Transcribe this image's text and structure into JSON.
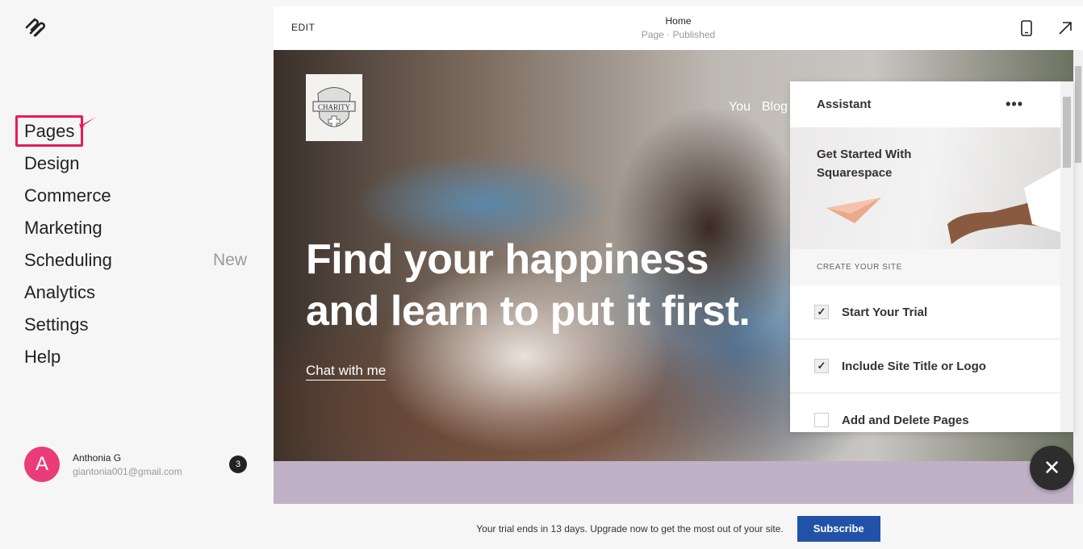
{
  "sidebar": {
    "items": [
      {
        "label": "Pages"
      },
      {
        "label": "Design"
      },
      {
        "label": "Commerce"
      },
      {
        "label": "Marketing"
      },
      {
        "label": "Scheduling",
        "badge": "New"
      },
      {
        "label": "Analytics"
      },
      {
        "label": "Settings"
      },
      {
        "label": "Help"
      }
    ],
    "user": {
      "initial": "A",
      "name": "Anthonia G",
      "email": "giantonia001@gmail.com",
      "notifications": "3"
    },
    "highlight_color": "#e8195f"
  },
  "header": {
    "edit": "EDIT",
    "title": "Home",
    "subtitle": "Page · Published"
  },
  "hero": {
    "logo_text": "CHARITY",
    "nav": [
      "You",
      "Blog"
    ],
    "headline_1": "Find your happiness",
    "headline_2": "and learn to put it first.",
    "cta": "Chat with me"
  },
  "assistant": {
    "title": "Assistant",
    "more": "•••",
    "banner": "Get Started With Squarespace",
    "section": "CREATE YOUR SITE",
    "tasks": [
      {
        "label": "Start Your Trial",
        "done": true
      },
      {
        "label": "Include Site Title or Logo",
        "done": true
      },
      {
        "label": "Add and Delete Pages",
        "done": false
      }
    ]
  },
  "close": "✕",
  "trial": {
    "message": "Your trial ends in 13 days. Upgrade now to get the most out of your site.",
    "button": "Subscribe",
    "button_color": "#2251a8"
  }
}
